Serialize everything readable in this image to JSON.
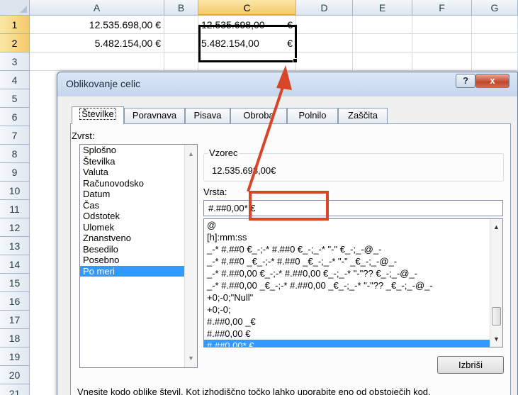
{
  "spreadsheet": {
    "columns": [
      "A",
      "B",
      "C",
      "D",
      "E",
      "F",
      "G"
    ],
    "rows": [
      "1",
      "2",
      "3",
      "4",
      "5",
      "6",
      "7",
      "8",
      "9",
      "10",
      "11",
      "12",
      "13",
      "14",
      "15",
      "16",
      "17",
      "18",
      "19",
      "20",
      "21"
    ],
    "cells": {
      "A1": "12.535.698,00 €",
      "A2": "5.482.154,00 €",
      "C1_num": "12.535.698,00",
      "C1_sym": "€",
      "C2_num": "5.482.154,00",
      "C2_sym": "€"
    }
  },
  "dialog": {
    "title": "Oblikovanje celic",
    "help_label": "?",
    "close_label": "x",
    "tabs": [
      "Številke",
      "Poravnava",
      "Pisava",
      "Obroba",
      "Polnilo",
      "Zaščita"
    ],
    "category_label": "Zvrst:",
    "categories": [
      "Splošno",
      "Številka",
      "Valuta",
      "Računovodsko",
      "Datum",
      "Čas",
      "Odstotek",
      "Ulomek",
      "Znanstveno",
      "Besedilo",
      "Posebno",
      "Po meri"
    ],
    "selected_category": "Po meri",
    "sample_label": "Vzorec",
    "sample_value": "12.535.698,00€",
    "type_label": "Vrsta:",
    "type_value": "#.##0,00* €",
    "formats": [
      "@",
      "[h]:mm:ss",
      "_-* #.##0 €_-;-* #.##0 €_-;_-* \"-\" €_-;_-@_-",
      "_-* #.##0 _€_-;-* #.##0 _€_-;_-* \"-\" _€_-;_-@_-",
      "_-* #.##0,00 €_-;-* #.##0,00 €_-;_-* \"-\"?? €_-;_-@_-",
      "_-* #.##0,00 _€_-;-* #.##0,00 _€_-;_-* \"-\"?? _€_-;_-@_-",
      "+0;-0;\"Null\"",
      "+0;-0;",
      "#.##0,00 _€",
      "#.##0,00 €",
      "#.##0,00* €"
    ],
    "selected_format": "#.##0,00* €",
    "delete_label": "Izbriši",
    "description": "Vnesite kodo oblike števil. Kot izhodiščno točko lahko uporabite eno od obstoječih kod."
  },
  "colors": {
    "annotation_red": "#d8462a",
    "selection_blue": "#3399ff",
    "header_selected": "#f5c96b"
  }
}
